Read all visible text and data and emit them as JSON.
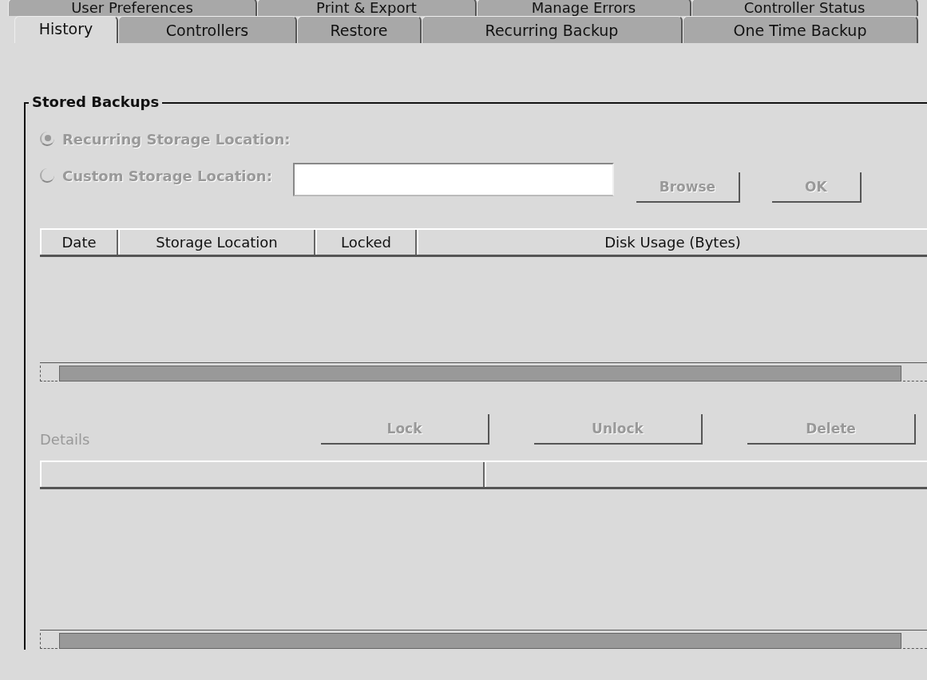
{
  "tab_rows": [
    [
      {
        "label": "User Preferences",
        "selected": false
      },
      {
        "label": "Print & Export",
        "selected": false
      },
      {
        "label": "Manage Errors",
        "selected": false
      },
      {
        "label": "Controller Status",
        "selected": false
      }
    ],
    [
      {
        "label": "History",
        "selected": true
      },
      {
        "label": "Controllers",
        "selected": false
      },
      {
        "label": "Restore",
        "selected": false
      },
      {
        "label": "Recurring Backup",
        "selected": false
      },
      {
        "label": "One Time Backup",
        "selected": false
      }
    ]
  ],
  "group": {
    "title": "Stored Backups",
    "radios": [
      {
        "label": "Recurring Storage Location:",
        "selected": true,
        "disabled": true
      },
      {
        "label": "Custom Storage Location:",
        "selected": false,
        "disabled": true
      }
    ],
    "location_buttons": [
      {
        "label": "Browse",
        "disabled": true
      },
      {
        "label": "OK",
        "disabled": true
      }
    ],
    "table": {
      "columns": [
        "Date",
        "Storage Location",
        "Locked",
        "Disk Usage (Bytes)"
      ]
    },
    "details": {
      "label": "Details",
      "disabled": true
    },
    "details_buttons": [
      {
        "label": "Lock",
        "disabled": true
      },
      {
        "label": "Unlock",
        "disabled": true
      },
      {
        "label": "Delete",
        "disabled": true
      }
    ]
  }
}
